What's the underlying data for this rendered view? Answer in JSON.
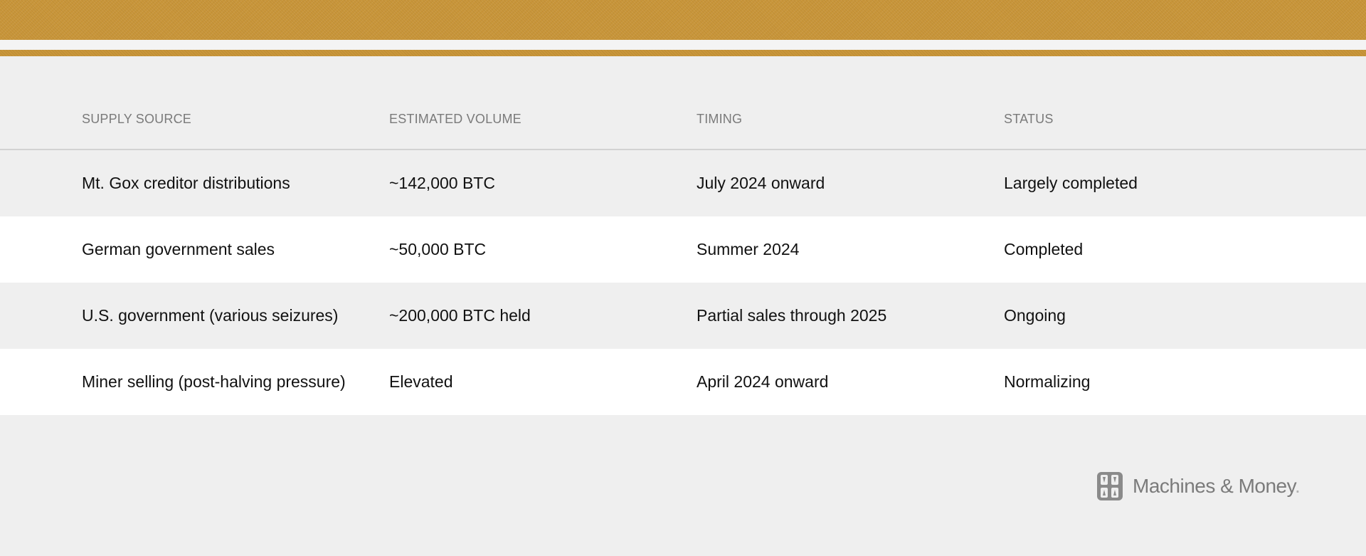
{
  "table": {
    "headers": [
      "SUPPLY SOURCE",
      "ESTIMATED VOLUME",
      "TIMING",
      "STATUS"
    ],
    "rows": [
      [
        "Mt. Gox creditor distributions",
        "~142,000 BTC",
        "July 2024 onward",
        "Largely completed"
      ],
      [
        "German government sales",
        "~50,000 BTC",
        "Summer 2024",
        "Completed"
      ],
      [
        "U.S. government (various seizures)",
        "~200,000 BTC held",
        "Partial sales through 2025",
        "Ongoing"
      ],
      [
        "Miner selling (post-halving pressure)",
        "Elevated",
        "April 2024 onward",
        "Normalizing"
      ]
    ]
  },
  "brand": {
    "name": "Machines & Money",
    "dot": ".",
    "logo_icon": "machines-money-logo-icon"
  },
  "colors": {
    "accent_gold": "#c9963a",
    "background": "#efefef",
    "row_white": "#ffffff"
  }
}
